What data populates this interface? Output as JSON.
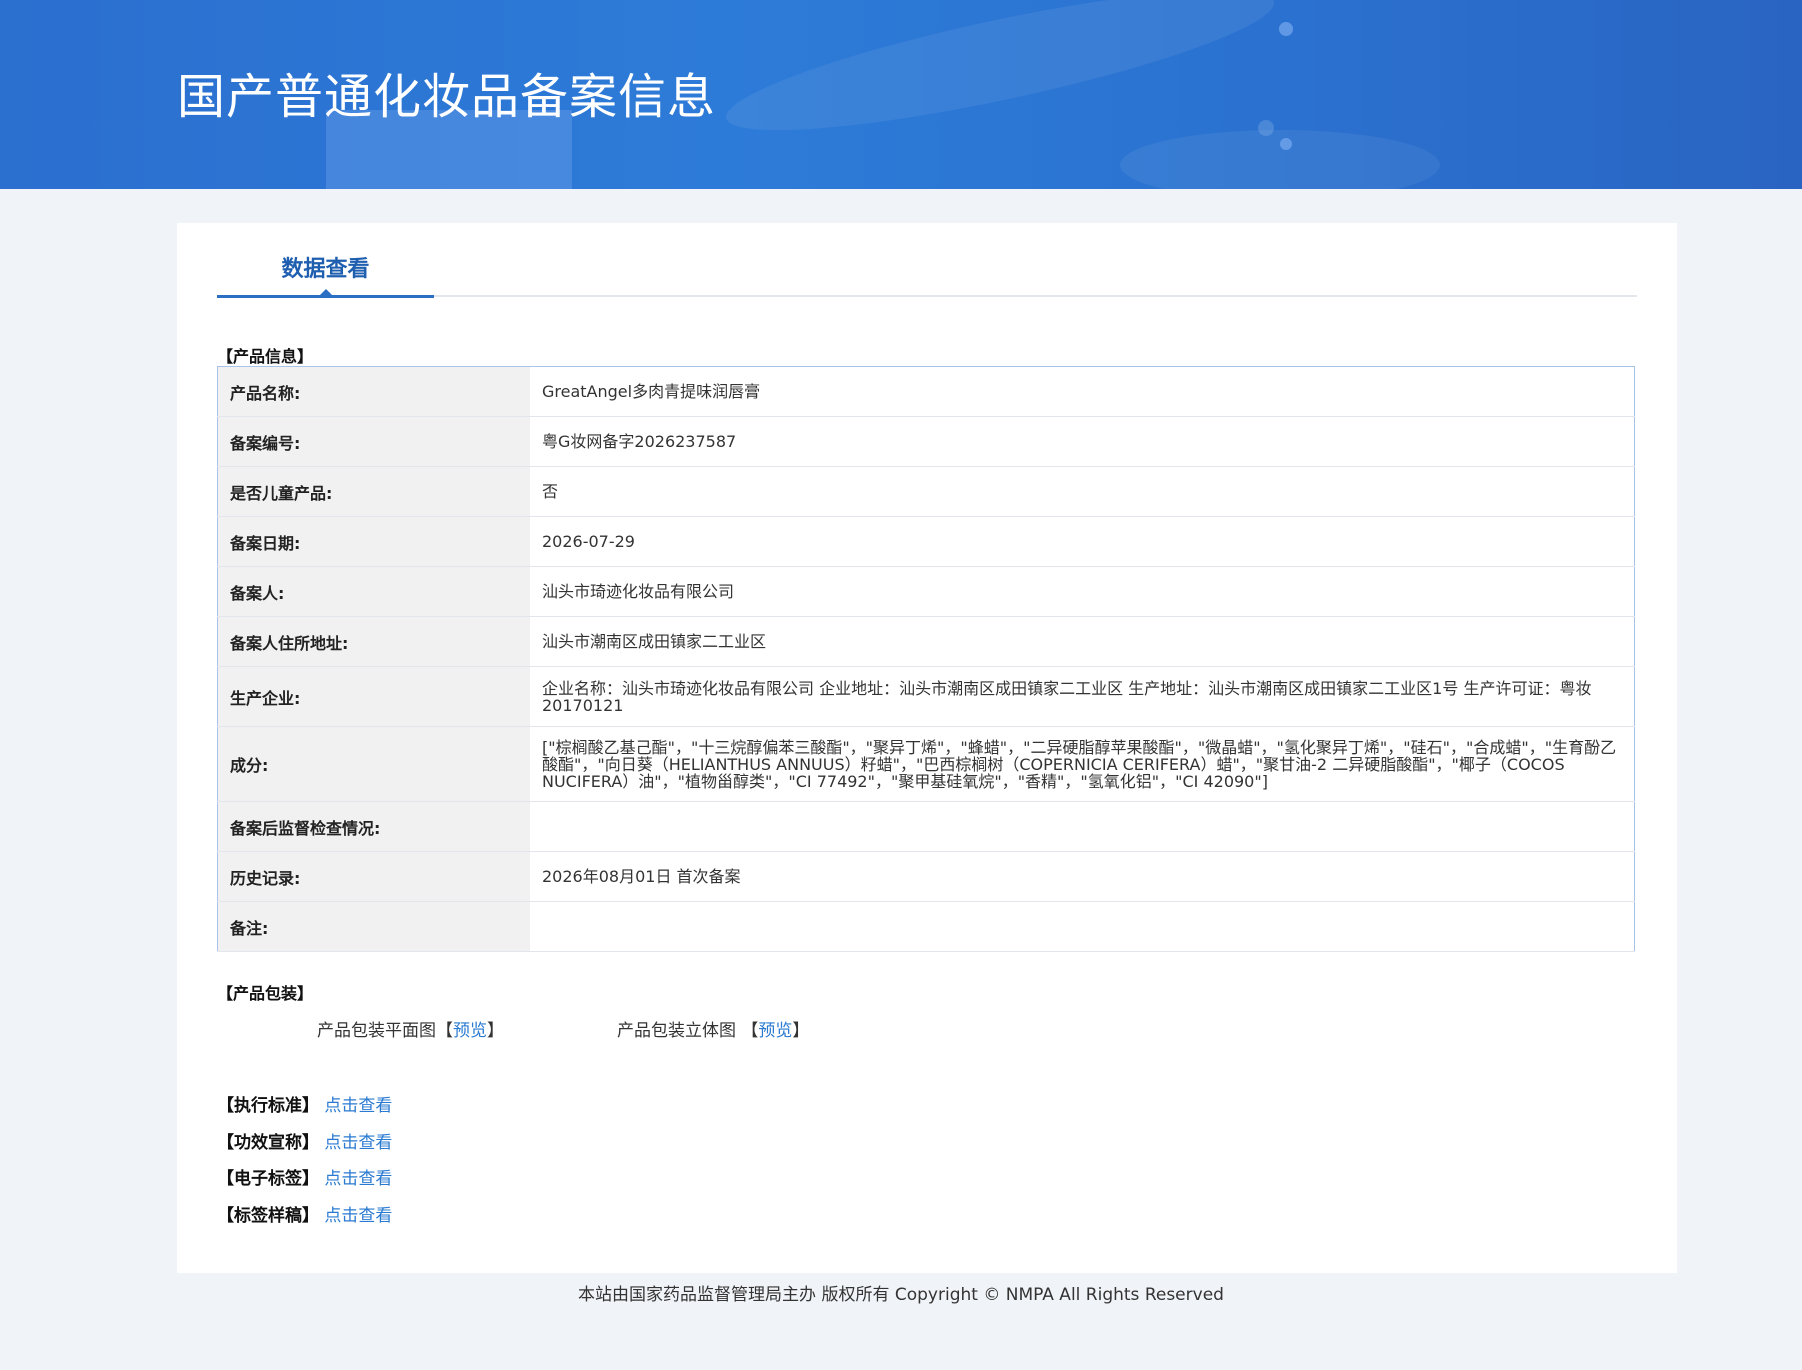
{
  "header": {
    "title": "国产普通化妆品备案信息"
  },
  "tabs": [
    {
      "label": "数据查看"
    }
  ],
  "product_info": {
    "section_label": "【产品信息】",
    "rows": [
      {
        "key": "产品名称:",
        "value": "GreatAngel多肉青提味润唇膏"
      },
      {
        "key": "备案编号:",
        "value": "粤G妆网备字2026237587"
      },
      {
        "key": "是否儿童产品:",
        "value": "否"
      },
      {
        "key": "备案日期:",
        "value": "2026-07-29"
      },
      {
        "key": "备案人:",
        "value": "汕头市琦迹化妆品有限公司"
      },
      {
        "key": "备案人住所地址:",
        "value": "汕头市潮南区成田镇家二工业区"
      },
      {
        "key": "生产企业:",
        "value": "企业名称：汕头市琦迹化妆品有限公司 企业地址：汕头市潮南区成田镇家二工业区 生产地址：汕头市潮南区成田镇家二工业区1号 生产许可证：粤妆20170121"
      },
      {
        "key": "成分:",
        "value": "[\"棕榈酸乙基己酯\"，\"十三烷醇偏苯三酸酯\"，\"聚异丁烯\"，\"蜂蜡\"，\"二异硬脂醇苹果酸酯\"，\"微晶蜡\"，\"氢化聚异丁烯\"，\"硅石\"，\"合成蜡\"，\"生育酚乙酸酯\"，\"向日葵（HELIANTHUS ANNUUS）籽蜡\"，\"巴西棕榈树（COPERNICIA CERIFERA）蜡\"，\"聚甘油-2 二异硬脂酸酯\"，\"椰子（COCOS NUCIFERA）油\"，\"植物甾醇类\"，\"CI 77492\"，\"聚甲基硅氧烷\"，\"香精\"，\"氢氧化铝\"，\"CI 42090\"]"
      },
      {
        "key": "备案后监督检查情况:",
        "value": ""
      },
      {
        "key": "历史记录:",
        "value": "2026年08月01日 首次备案"
      },
      {
        "key": "备注:",
        "value": ""
      }
    ]
  },
  "packaging": {
    "section_label": "【产品包装】",
    "flat": {
      "label": "产品包装平面图",
      "open": "【",
      "link": "预览",
      "close": "】"
    },
    "solid": {
      "label": "产品包装立体图 ",
      "open": "【",
      "link": "预览",
      "close": "】"
    }
  },
  "documents": [
    {
      "label": "【执行标准】",
      "link": "点击查看"
    },
    {
      "label": "【功效宣称】",
      "link": "点击查看"
    },
    {
      "label": "【电子标签】",
      "link": "点击查看"
    },
    {
      "label": "【标签样稿】",
      "link": "点击查看"
    }
  ],
  "footer": {
    "text": "本站由国家药品监督管理局主办 版权所有 Copyright © NMPA All Rights Reserved"
  }
}
